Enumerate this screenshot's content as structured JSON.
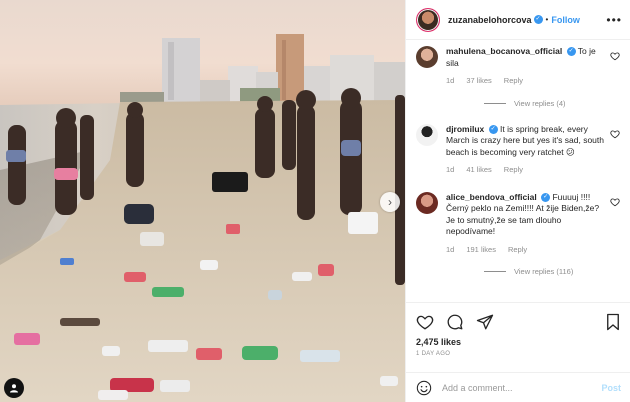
{
  "post": {
    "username": "zuzanabelohorcova",
    "follow_label": "Follow",
    "separator": "•"
  },
  "comments": [
    {
      "username": "mahulena_bocanova_official",
      "text": "To je sila",
      "age": "1d",
      "likes": "37 likes",
      "reply_label": "Reply",
      "view_replies": "View replies (4)"
    },
    {
      "username": "djromilux",
      "text": "It is spring break, every March is crazy here but yes it's sad, south beach is becoming very ratchet 😕",
      "age": "1d",
      "likes": "41 likes",
      "reply_label": "Reply",
      "view_replies": ""
    },
    {
      "username": "alice_bendova_official",
      "text": "Fuuuuj !!!! Černý peklo na Zemi!!!! At žije Biden,že? Je to smutný,že se tam dlouho nepodívame!",
      "age": "1d",
      "likes": "191 likes",
      "reply_label": "Reply",
      "view_replies": "View replies (116)"
    }
  ],
  "footer": {
    "likes": "2,475 likes",
    "time_ago": "1 DAY AGO",
    "comment_placeholder": "Add a comment...",
    "post_label": "Post"
  },
  "icons": {
    "like": "heart-icon",
    "comment": "comment-icon",
    "share": "share-icon",
    "save": "bookmark-icon",
    "emoji": "emoji-icon",
    "next": "chevron-right-icon",
    "tag": "user-tag-icon",
    "more": "more-options-icon"
  },
  "colors": {
    "accent": "#3897f0",
    "text": "#262626",
    "meta": "#8e8e8e",
    "post_disabled": "#b2dffc"
  }
}
